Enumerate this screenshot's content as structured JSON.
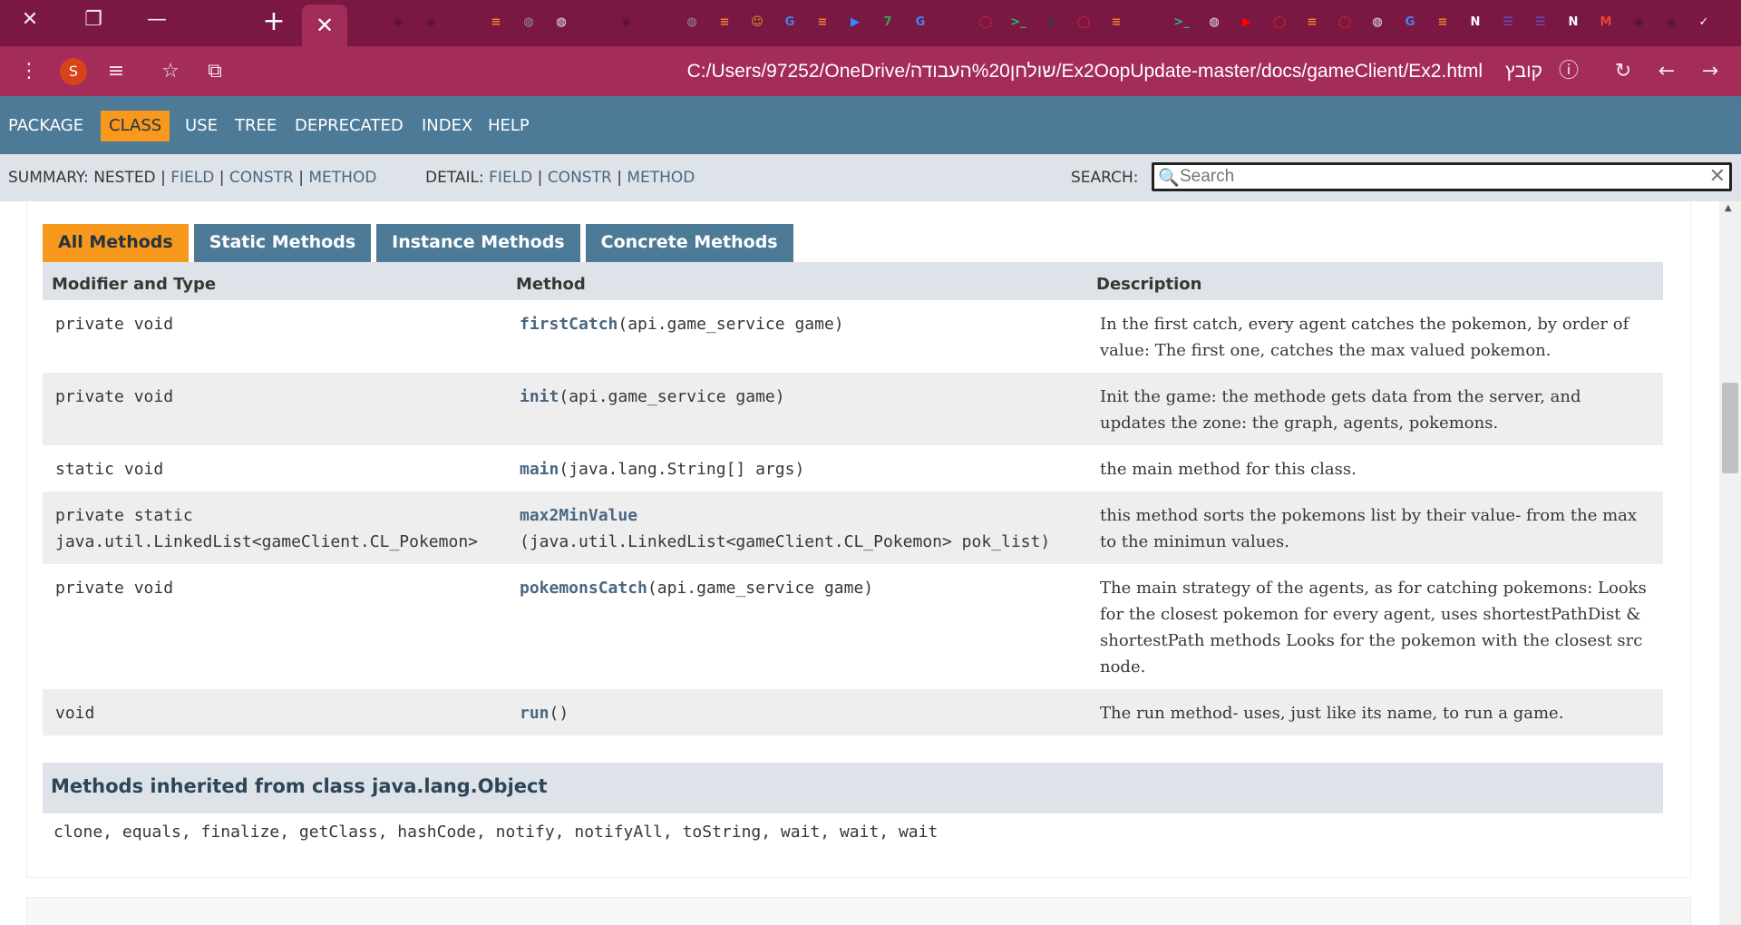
{
  "browser": {
    "window_buttons": [
      "✕",
      "❐",
      "—"
    ],
    "new_tab_icon": "+",
    "active_tab_close": "✕",
    "tab_icons": [
      {
        "name": "loading-icon",
        "glyph": "↻",
        "color": "#7a1843"
      },
      {
        "name": "github-icon",
        "glyph": "◉",
        "color": "#5a1433"
      },
      {
        "name": "github-icon",
        "glyph": "◉",
        "color": "#5a1433"
      },
      {
        "name": "loading-icon",
        "glyph": "↻",
        "color": "#7a1843"
      },
      {
        "name": "stackoverflow-icon",
        "glyph": "≡",
        "color": "#f48024"
      },
      {
        "name": "globe-icon",
        "glyph": "◍",
        "color": "#9a8a93"
      },
      {
        "name": "globe-icon",
        "glyph": "◍",
        "color": "#e9e9e9"
      },
      {
        "name": "loading-icon",
        "glyph": "↻",
        "color": "#7a1843"
      },
      {
        "name": "github-icon",
        "glyph": "◉",
        "color": "#5a1433"
      },
      {
        "name": "loading-icon",
        "glyph": "↻",
        "color": "#7a1843"
      },
      {
        "name": "globe-icon",
        "glyph": "◍",
        "color": "#9a8a93"
      },
      {
        "name": "stackoverflow-icon",
        "glyph": "≡",
        "color": "#f48024"
      },
      {
        "name": "avatar-icon",
        "glyph": "☺",
        "color": "#d4a017"
      },
      {
        "name": "google-icon",
        "glyph": "G",
        "color": "#4285f4"
      },
      {
        "name": "stackoverflow-icon",
        "glyph": "≡",
        "color": "#f48024"
      },
      {
        "name": "zoom-icon",
        "glyph": "▶",
        "color": "#2d8cff"
      },
      {
        "name": "number-icon",
        "glyph": "7",
        "color": "#34a853"
      },
      {
        "name": "google-icon",
        "glyph": "G",
        "color": "#4285f4"
      },
      {
        "name": "loading-icon",
        "glyph": "↻",
        "color": "#7a1843"
      },
      {
        "name": "oracle-icon",
        "glyph": "◯",
        "color": "#e0202a"
      },
      {
        "name": "terminal-icon",
        "glyph": ">_",
        "color": "#2bb673"
      },
      {
        "name": "diamond-icon",
        "glyph": "◈",
        "color": "#3d3d3d"
      },
      {
        "name": "oracle-icon",
        "glyph": "◯",
        "color": "#e0202a"
      },
      {
        "name": "stackoverflow-icon",
        "glyph": "≡",
        "color": "#f48024"
      },
      {
        "name": "loading-icon",
        "glyph": "↻",
        "color": "#7a1843"
      },
      {
        "name": "terminal-icon",
        "glyph": ">_",
        "color": "#2bb673"
      },
      {
        "name": "globe-icon",
        "glyph": "◍",
        "color": "#e9e9e9"
      },
      {
        "name": "youtube-icon",
        "glyph": "▶",
        "color": "#ff0000"
      },
      {
        "name": "oracle-icon",
        "glyph": "◯",
        "color": "#e0202a"
      },
      {
        "name": "stackoverflow-icon",
        "glyph": "≡",
        "color": "#f48024"
      },
      {
        "name": "oracle-icon",
        "glyph": "◯",
        "color": "#e0202a"
      },
      {
        "name": "globe-icon",
        "glyph": "◍",
        "color": "#e9e9e9"
      },
      {
        "name": "google-icon",
        "glyph": "G",
        "color": "#4285f4"
      },
      {
        "name": "stackoverflow-icon",
        "glyph": "≡",
        "color": "#f48024"
      },
      {
        "name": "notion-icon",
        "glyph": "N",
        "color": "#ffffff"
      },
      {
        "name": "list-icon",
        "glyph": "☰",
        "color": "#5b5bd6"
      },
      {
        "name": "list-icon",
        "glyph": "☰",
        "color": "#5b5bd6"
      },
      {
        "name": "notion-icon",
        "glyph": "N",
        "color": "#ffffff"
      },
      {
        "name": "gmail-icon",
        "glyph": "M",
        "color": "#ea4335"
      },
      {
        "name": "github-icon",
        "glyph": "◉",
        "color": "#5a1433"
      },
      {
        "name": "github-icon",
        "glyph": "◉",
        "color": "#5a1433"
      },
      {
        "name": "check-icon",
        "glyph": "✓",
        "color": "#ffffff"
      }
    ],
    "toolbar": {
      "menu_icon": "⋮",
      "avatar_letter": "S",
      "playlist_icon": "≡",
      "star_icon": "☆",
      "cast_icon": "⧉",
      "url": "C:/Users/97252/OneDrive/שולחן%20העבודה/Ex2OopUpdate-master/docs/gameClient/Ex2.html",
      "url_label": "קובץ",
      "info_icon": "ⓘ",
      "reload_icon": "↻",
      "back_icon": "←",
      "forward_icon": "→"
    }
  },
  "nav": {
    "items": [
      "PACKAGE",
      "CLASS",
      "USE",
      "TREE",
      "DEPRECATED",
      "INDEX",
      "HELP"
    ],
    "active": "CLASS"
  },
  "subnav": {
    "summary_label": "SUMMARY:",
    "summary_nested": "NESTED",
    "summary_links": [
      "FIELD",
      "CONSTR",
      "METHOD"
    ],
    "detail_label": "DETAIL:",
    "detail_links": [
      "FIELD",
      "CONSTR",
      "METHOD"
    ],
    "sep": "|",
    "search_label": "SEARCH:",
    "search_placeholder": "Search",
    "search_icon": "🔍",
    "clear_icon": "✕"
  },
  "method_tabs": [
    "All Methods",
    "Static Methods",
    "Instance Methods",
    "Concrete Methods"
  ],
  "active_method_tab": "All Methods",
  "table": {
    "headers": [
      "Modifier and Type",
      "Method",
      "Description"
    ],
    "rows": [
      {
        "modifier": "private void",
        "name": "firstCatch",
        "params": "(api.game_service game)",
        "desc": "In the first catch, every agent catches the pokemon, by order of value: The first one, catches the max valued pokemon."
      },
      {
        "modifier": "private void",
        "name": "init",
        "params": "(api.game_service game)",
        "desc": "Init the game: the methode gets data from the server, and updates the zone: the graph, agents, pokemons."
      },
      {
        "modifier": "static void",
        "name": "main",
        "params": "(java.lang.String[] args)",
        "desc": "the main method for this class."
      },
      {
        "modifier": "private static java.util.LinkedList<gameClient.CL_Pokemon>",
        "name": "max2MinValue",
        "params": "(java.util.LinkedList<gameClient.CL_Pokemon> pok_list)",
        "desc": "this method sorts the pokemons list by their value- from the max to the minimun values.",
        "modifier_break": true,
        "params_break": true
      },
      {
        "modifier": "private void",
        "name": "pokemonsCatch",
        "params": "(api.game_service game)",
        "desc": "The main strategy of the agents, as for catching pokemons: Looks for the closest pokemon for every agent, uses shortestPathDist & shortestPath methods Looks for the pokemon with the closest src node."
      },
      {
        "modifier": "void",
        "name": "run",
        "params": "()",
        "desc": "The run method- uses, just like its name, to run a game."
      }
    ]
  },
  "inherited": {
    "title": "Methods inherited from class java.lang.Object",
    "methods": "clone, equals, finalize, getClass, hashCode, notify, notifyAll, toString, wait, wait, wait"
  },
  "colors": {
    "tabstrip": "#7a1843",
    "toolbar": "#a32c59",
    "nav": "#4d7a97",
    "accent": "#f8981d",
    "subnav": "#dee3e9",
    "link": "#4a6782"
  }
}
